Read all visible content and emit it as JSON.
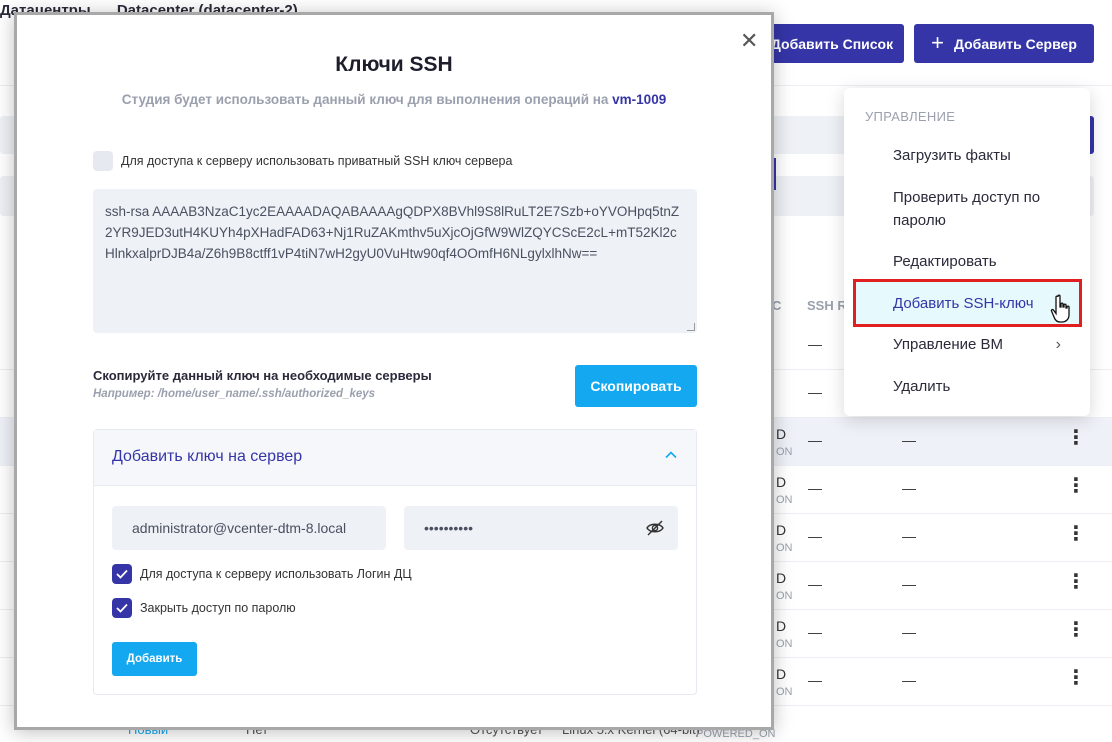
{
  "background": {
    "breadcrumbs": [
      "Датацентры",
      "Datacenter (datacenter-2)"
    ],
    "buttons": {
      "add_list": "Добавить Список",
      "add_server": "Добавить Сервер",
      "add_server_icon": "plus-icon"
    },
    "table": {
      "columns": [
        "SSH R",
        "C"
      ],
      "rows": [
        {
          "status_d": "",
          "status_n": "",
          "c1": "—",
          "c2": ""
        },
        {
          "status_d": "",
          "status_n": "",
          "c1": "—",
          "c2": ""
        },
        {
          "status_d": "D",
          "status_n": "ON",
          "c1": "—",
          "c2": "—"
        },
        {
          "status_d": "D",
          "status_n": "ON",
          "c1": "—",
          "c2": "—"
        },
        {
          "status_d": "D",
          "status_n": "ON",
          "c1": "—",
          "c2": "—"
        },
        {
          "status_d": "D",
          "status_n": "ON",
          "c1": "—",
          "c2": "—"
        },
        {
          "status_d": "D",
          "status_n": "ON",
          "c1": "—",
          "c2": "—"
        },
        {
          "status_d": "D",
          "status_n": "ON",
          "c1": "—",
          "c2": "—"
        }
      ],
      "bottom_row": {
        "new": "Новый",
        "none": "Нет",
        "missing": "Отсутствует",
        "os": "Linux 5.x Kernel (64-bit)",
        "powered": "POWERED_ON"
      }
    }
  },
  "context_menu": {
    "header": "УПРАВЛЕНИЕ",
    "items": [
      {
        "label": "Загрузить факты"
      },
      {
        "label": "Проверить доступ по паролю"
      },
      {
        "label": "Редактировать"
      },
      {
        "label": "Добавить SSH-ключ",
        "active": true
      },
      {
        "label": "Управление ВМ",
        "submenu": true
      },
      {
        "label": "Удалить"
      }
    ]
  },
  "modal": {
    "title": "Ключи SSH",
    "subtitle_prefix": "Студия будет использовать данный ключ для выполнения операций на",
    "vm_name": "vm-1009",
    "private_key_checkbox_label": "Для доступа к серверу использовать приватный SSH ключ сервера",
    "private_key_checked": false,
    "key_text": "ssh-rsa AAAAB3NzaC1yc2EAAAADAQABAAAAgQDPX8BVhl9S8lRuLT2E7Szb+oYVOHpq5tnZ2YR9JED3utH4KUYh4pXHadFAD63+Nj1RuZAKmthv5uXjcOjGfW9WlZQYCScE2cL+mT52Kl2cHlnkxalprDJB4a/Z6h9B8ctff1vP4tiN7wH2gyU0VuHtw90qf4OOmfH6NLgylxlhNw==",
    "copy_label": "Скопируйте данный ключ на необходимые серверы",
    "copy_hint": "Например: /home/user_name/.ssh/authorized_keys",
    "copy_button": "Скопировать",
    "accordion": {
      "title": "Добавить ключ на сервер",
      "login_value": "administrator@vcenter-dtm-8.local",
      "password_value": "••••••••••",
      "use_dc_login_label": "Для доступа к серверу использовать Логин ДЦ",
      "use_dc_login_checked": true,
      "close_password_label": "Закрыть доступ по паролю",
      "close_password_checked": true,
      "add_button": "Добавить"
    }
  },
  "colors": {
    "primary": "#3535a8",
    "accent": "#14a8f0",
    "highlight_border": "#e02020",
    "highlight_bg": "#e6f9fc"
  }
}
